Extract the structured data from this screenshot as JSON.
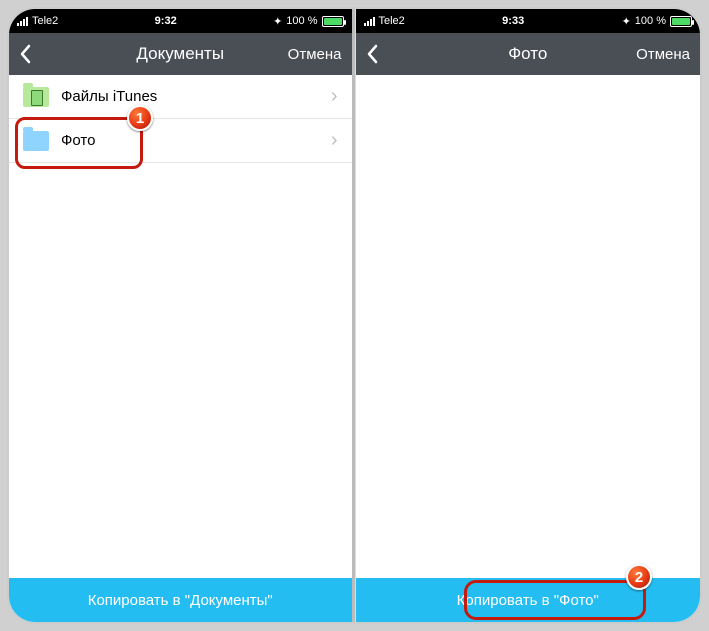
{
  "left": {
    "statusbar": {
      "carrier": "Tele2",
      "time": "9:32",
      "battery": "100 %"
    },
    "nav": {
      "title": "Документы",
      "cancel": "Отмена"
    },
    "rows": [
      {
        "label": "Файлы iTunes"
      },
      {
        "label": "Фото"
      }
    ],
    "action": "Копировать в \"Документы\""
  },
  "right": {
    "statusbar": {
      "carrier": "Tele2",
      "time": "9:33",
      "battery": "100 %"
    },
    "nav": {
      "title": "Фото",
      "cancel": "Отмена"
    },
    "action": "Копировать в \"Фото\""
  },
  "callouts": {
    "one": "1",
    "two": "2"
  }
}
